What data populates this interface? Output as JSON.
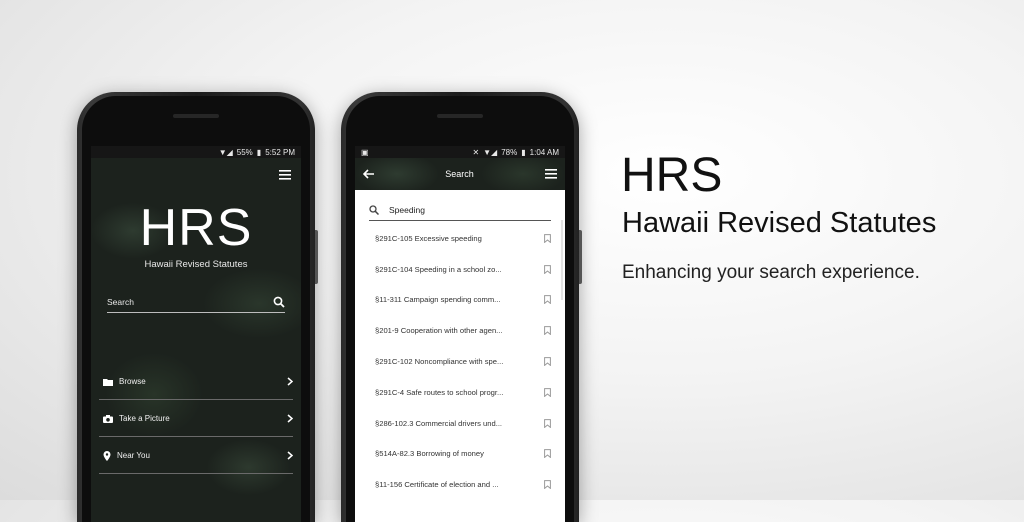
{
  "phone1": {
    "status": {
      "signal": "▼◢",
      "battery": "55%",
      "time": "5:52 PM"
    },
    "logo": "HRS",
    "subtitle": "Hawaii Revised Statutes",
    "search_placeholder": "Search",
    "nav": [
      {
        "label": "Browse",
        "icon": "folder-icon"
      },
      {
        "label": "Take a Picture",
        "icon": "camera-icon"
      },
      {
        "label": "Near You",
        "icon": "location-pin-icon"
      }
    ]
  },
  "phone2": {
    "status": {
      "battery": "78%",
      "time": "1:04 AM"
    },
    "toolbar_title": "Search",
    "query": "Speeding",
    "results": [
      "§291C-105 Excessive speeding",
      "§291C-104 Speeding in a school zo...",
      "§11-311 Campaign spending comm...",
      "§201-9 Cooperation with other agen...",
      "§291C-102 Noncompliance with spe...",
      "§291C-4 Safe routes to school progr...",
      "§286-102.3 Commercial drivers und...",
      "§514A-82.3 Borrowing of money",
      "§11-156 Certificate of election and ..."
    ]
  },
  "hero": {
    "title": "HRS",
    "subtitle": "Hawaii Revised Statutes",
    "tagline": "Enhancing your search experience."
  }
}
